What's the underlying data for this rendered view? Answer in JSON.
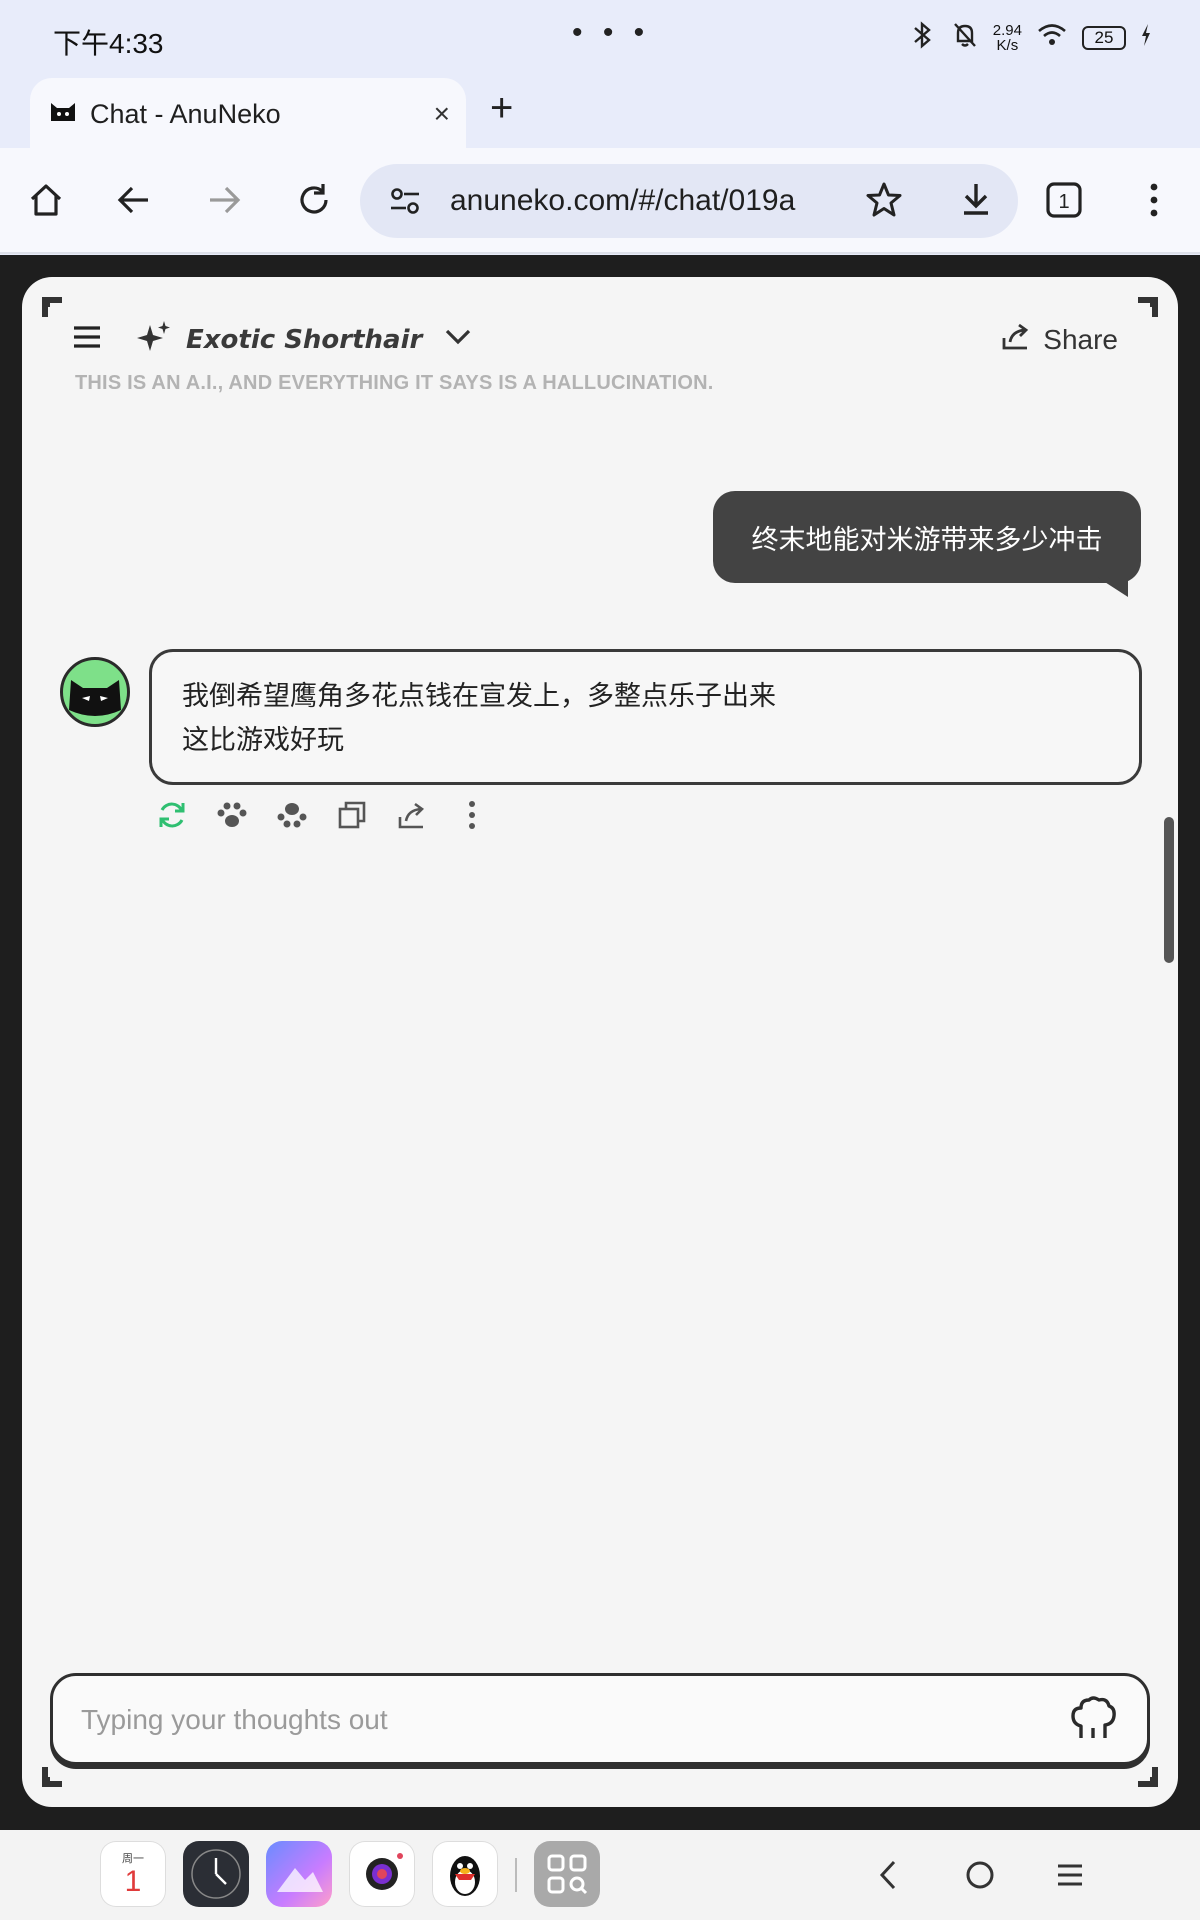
{
  "status_bar": {
    "time": "下午4:33",
    "dots": "• • •",
    "net_speed_value": "2.94",
    "net_speed_unit": "K/s",
    "battery": "25"
  },
  "tab": {
    "title": "Chat - AnuNeko",
    "close": "×",
    "new_tab": "+"
  },
  "toolbar": {
    "url": "anuneko.com/#/chat/019a",
    "tab_count": "1"
  },
  "chat": {
    "model_name": "Exotic Shorthair",
    "share_label": "Share",
    "disclaimer": "THIS IS AN A.I., AND EVERYTHING IT SAYS IS A HALLUCINATION.",
    "messages": [
      {
        "role": "user",
        "text": "终末地能对米游带来多少冲击"
      },
      {
        "role": "assistant",
        "lines": [
          "我倒希望鹰角多花点钱在宣发上，多整点乐子出来",
          "这比游戏好玩"
        ]
      }
    ],
    "input_placeholder": "Typing your thoughts out"
  },
  "dock": {
    "calendar_weekday": "周一",
    "calendar_day": "1"
  },
  "colors": {
    "accent_green": "#2fbf71",
    "user_bubble": "#434343",
    "avatar_bg": "#7ee089"
  }
}
